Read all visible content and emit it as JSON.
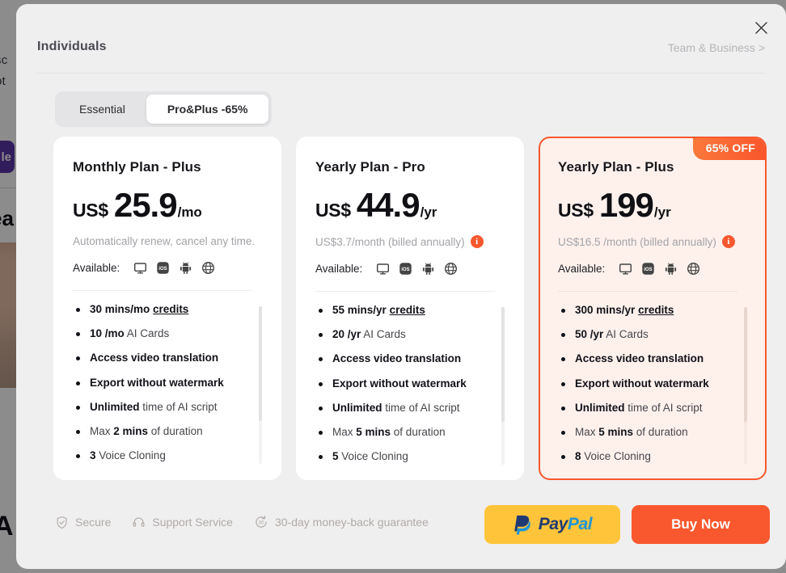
{
  "background": {
    "text_line_1": "sc",
    "text_line_2": "ot",
    "chip_label": "le",
    "heading": "ea",
    "big_letter": "A"
  },
  "modal": {
    "close_label": "×",
    "header": {
      "title": "Individuals",
      "secondary_link": "Team & Business >"
    },
    "tabs": [
      {
        "label": "Essential",
        "active": false
      },
      {
        "label": "Pro&Plus -65%",
        "active": true
      }
    ],
    "plans": [
      {
        "name": "Monthly Plan - Plus",
        "currency": "US$",
        "amount": "25.9",
        "period": "/mo",
        "subnote": "Automatically renew, cancel any time.",
        "has_info_icon": false,
        "available_label": "Available:",
        "platforms": [
          "desktop-icon",
          "ios-icon",
          "android-icon",
          "web-icon"
        ],
        "featured": false,
        "badge": "",
        "features": [
          {
            "bold": "30 mins/mo",
            "link": "credits",
            "rest": ""
          },
          {
            "bold": "10 /mo",
            "link": "",
            "rest": " AI Cards"
          },
          {
            "bold": "Access video translation",
            "link": "",
            "rest": ""
          },
          {
            "bold": "Export without watermark",
            "link": "",
            "rest": ""
          },
          {
            "bold": "Unlimited",
            "link": "",
            "rest": " time of AI script"
          },
          {
            "pre": "Max ",
            "bold": "2 mins",
            "link": "",
            "rest": " of duration"
          },
          {
            "bold": "3",
            "link": "",
            "rest": " Voice Cloning"
          }
        ]
      },
      {
        "name": "Yearly Plan - Pro",
        "currency": "US$",
        "amount": "44.9",
        "period": "/yr",
        "subnote": "US$3.7/month (billed annually)",
        "has_info_icon": true,
        "available_label": "Available:",
        "platforms": [
          "desktop-icon",
          "ios-icon",
          "android-icon",
          "web-icon"
        ],
        "featured": false,
        "badge": "",
        "features": [
          {
            "bold": "55 mins/yr",
            "link": "credits",
            "rest": ""
          },
          {
            "bold": "20 /yr",
            "link": "",
            "rest": " AI Cards"
          },
          {
            "bold": "Access video translation",
            "link": "",
            "rest": ""
          },
          {
            "bold": "Export without watermark",
            "link": "",
            "rest": ""
          },
          {
            "bold": "Unlimited",
            "link": "",
            "rest": " time of AI script"
          },
          {
            "pre": "Max ",
            "bold": "5 mins",
            "link": "",
            "rest": " of duration"
          },
          {
            "bold": "5",
            "link": "",
            "rest": " Voice Cloning"
          }
        ]
      },
      {
        "name": "Yearly Plan - Plus",
        "currency": "US$",
        "amount": "199",
        "period": "/yr",
        "subnote": "US$16.5 /month (billed annually)",
        "has_info_icon": true,
        "available_label": "Available:",
        "platforms": [
          "desktop-icon",
          "ios-icon",
          "android-icon",
          "web-icon"
        ],
        "featured": true,
        "badge": "65% OFF",
        "features": [
          {
            "bold": "300 mins/yr",
            "link": "credits",
            "rest": ""
          },
          {
            "bold": "50 /yr",
            "link": "",
            "rest": " AI Cards"
          },
          {
            "bold": "Access video translation",
            "link": "",
            "rest": ""
          },
          {
            "bold": "Export without watermark",
            "link": "",
            "rest": ""
          },
          {
            "bold": "Unlimited",
            "link": "",
            "rest": " time of AI script"
          },
          {
            "pre": "Max ",
            "bold": "5 mins",
            "link": "",
            "rest": " of duration"
          },
          {
            "bold": "8",
            "link": "",
            "rest": " Voice Cloning"
          }
        ]
      }
    ],
    "footer": {
      "trust": [
        {
          "icon": "shield-check-icon",
          "label": "Secure"
        },
        {
          "icon": "headset-icon",
          "label": "Support Service"
        },
        {
          "icon": "refund-30-icon",
          "label": "30-day money-back guarantee"
        }
      ],
      "paypal": {
        "part1": "Pay",
        "part2": "Pal"
      },
      "buy_label": "Buy Now"
    }
  },
  "colors": {
    "accent_orange": "#f9582e",
    "badge_gradient_from": "#fb7a3c",
    "badge_gradient_to": "#f9542b",
    "featured_card_bg": "#fef1ec",
    "modal_bg": "#efeff0",
    "paypal_yellow": "#ffc43a",
    "paypal_navy": "#1f3a73",
    "paypal_blue": "#1d95d6"
  }
}
